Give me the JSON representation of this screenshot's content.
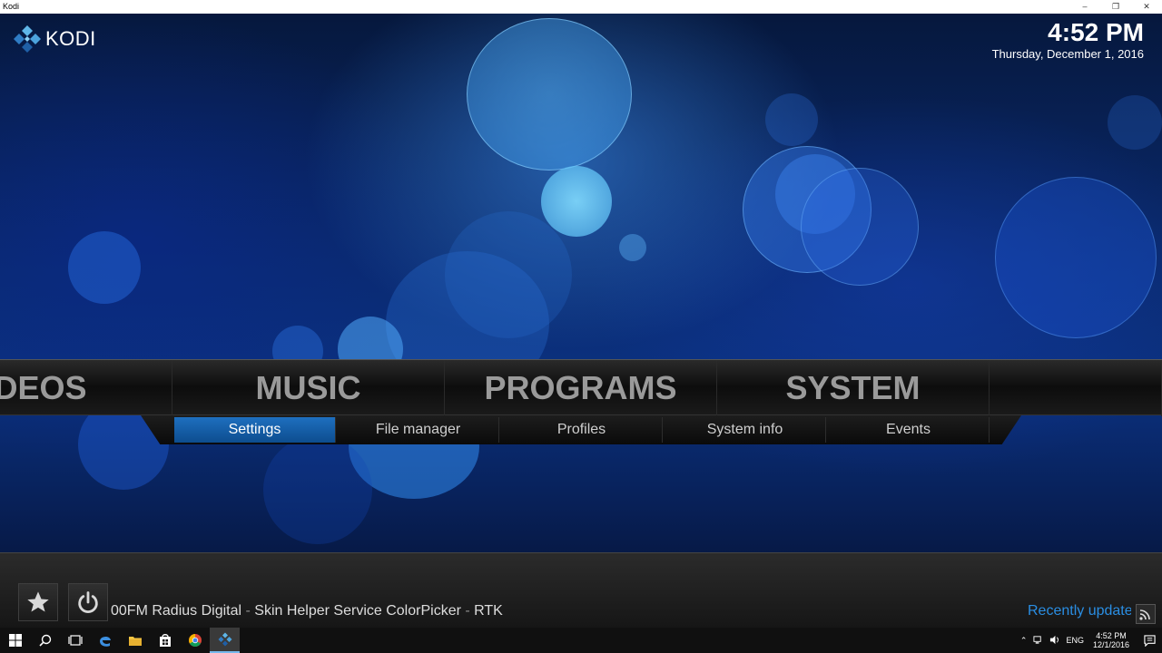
{
  "window": {
    "title": "Kodi",
    "controls": [
      "–",
      "❐",
      "✕"
    ]
  },
  "logo": {
    "text": "KODI"
  },
  "clock": {
    "time": "4:52 PM",
    "date": "Thursday, December 1, 2016"
  },
  "main_menu": {
    "items": [
      {
        "label": "IDEOS"
      },
      {
        "label": "MUSIC"
      },
      {
        "label": "PROGRAMS"
      },
      {
        "label": "SYSTEM"
      }
    ]
  },
  "sub_menu": {
    "items": [
      {
        "label": "Settings",
        "active": true
      },
      {
        "label": "File manager"
      },
      {
        "label": "Profiles"
      },
      {
        "label": "System info"
      },
      {
        "label": "Events"
      }
    ]
  },
  "bottom": {
    "ticker": {
      "part1": "00FM Radius Digital",
      "sep1": " - ",
      "part2": "Skin Helper Service ColorPicker",
      "sep2": " - ",
      "part3": "RTK"
    },
    "recently_updated": "Recently updated"
  },
  "taskbar": {
    "tray_language": "ENG",
    "time": "4:52 PM",
    "date": "12/1/2016"
  },
  "colors": {
    "accent": "#1e6fbf",
    "highlight_text": "#2a8ee3"
  }
}
